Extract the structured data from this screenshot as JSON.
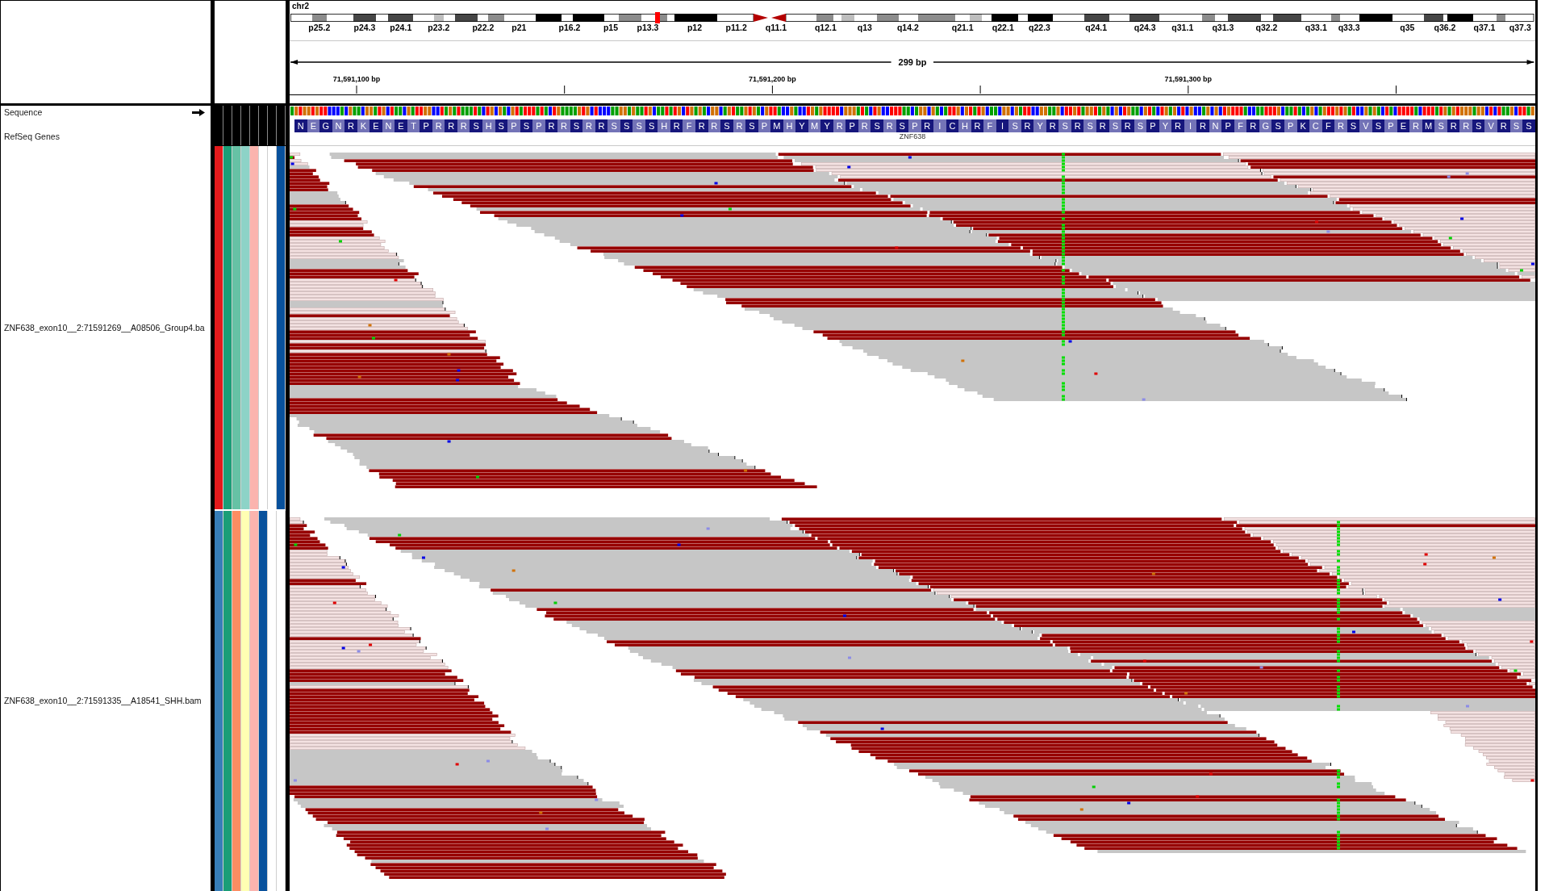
{
  "ideogram": {
    "chromosome": "chr2",
    "band_labels": [
      "p25.2",
      "p24.3",
      "p24.1",
      "p23.2",
      "p22.2",
      "p21",
      "p16.2",
      "p15",
      "p13.3",
      "p12",
      "p11.2",
      "q11.1",
      "q12.1",
      "q13",
      "q14.2",
      "q21.1",
      "q22.1",
      "q22.3",
      "q24.1",
      "q24.3",
      "q31.1",
      "q31.3",
      "q32.2",
      "q33.1",
      "q33.3",
      "q35",
      "q36.2",
      "q37.1",
      "q37.3"
    ]
  },
  "ruler": {
    "span": "299 bp",
    "tick_labels": [
      "71,591,100 bp",
      "71,591,200 bp",
      "71,591,300 bp"
    ]
  },
  "tracks": [
    {
      "kind": "sequence",
      "name": "Sequence"
    },
    {
      "kind": "gene",
      "name": "RefSeq Genes",
      "gene": "ZNF638",
      "amino_acids": [
        "N",
        "E",
        "G",
        "N",
        "R",
        "K",
        "E",
        "N",
        "E",
        "T",
        "P",
        "R",
        "R",
        "R",
        "S",
        "H",
        "S",
        "P",
        "S",
        "P",
        "R",
        "R",
        "S",
        "R",
        "R",
        "S",
        "S",
        "S",
        "S",
        "H",
        "R",
        "F",
        "R",
        "R",
        "S",
        "R",
        "S",
        "P",
        "M",
        "H",
        "Y",
        "M",
        "Y",
        "R",
        "P",
        "R",
        "S",
        "R",
        "S",
        "P",
        "R",
        "I",
        "C",
        "H",
        "R",
        "F",
        "I",
        "S",
        "R",
        "Y",
        "R",
        "S",
        "R",
        "S",
        "R",
        "S",
        "R",
        "S",
        "P",
        "Y",
        "R",
        "I",
        "R",
        "N",
        "P",
        "F",
        "R",
        "G",
        "S",
        "P",
        "K",
        "C",
        "F",
        "R",
        "S",
        "V",
        "S",
        "P",
        "E",
        "R",
        "M",
        "S",
        "R",
        "R",
        "S",
        "V",
        "R",
        "S",
        "S"
      ]
    },
    {
      "kind": "alignment",
      "name": "ZNF638_exon10__2:71591269__A08506_Group4.ba",
      "attributes": [
        {
          "color": "#e41a1c"
        },
        {
          "color": "#1b9e77"
        },
        {
          "color": "#66c2a5"
        },
        {
          "color": "#8dd3c7"
        },
        {
          "color": "#fbb4ae"
        },
        {
          "color": "#ffffff"
        },
        {
          "color": "#ffffff"
        },
        {
          "color": "#08519c"
        }
      ]
    },
    {
      "kind": "alignment",
      "name": "ZNF638_exon10__2:71591335__A18541_SHH.bam",
      "attributes": [
        {
          "color": "#377eb8"
        },
        {
          "color": "#1b9e77"
        },
        {
          "color": "#fc8d62"
        },
        {
          "color": "#ffffb3"
        },
        {
          "color": "#fbb4ae"
        },
        {
          "color": "#08519c"
        },
        {
          "color": "#ffffff"
        },
        {
          "color": "#ffffff"
        }
      ]
    }
  ]
}
